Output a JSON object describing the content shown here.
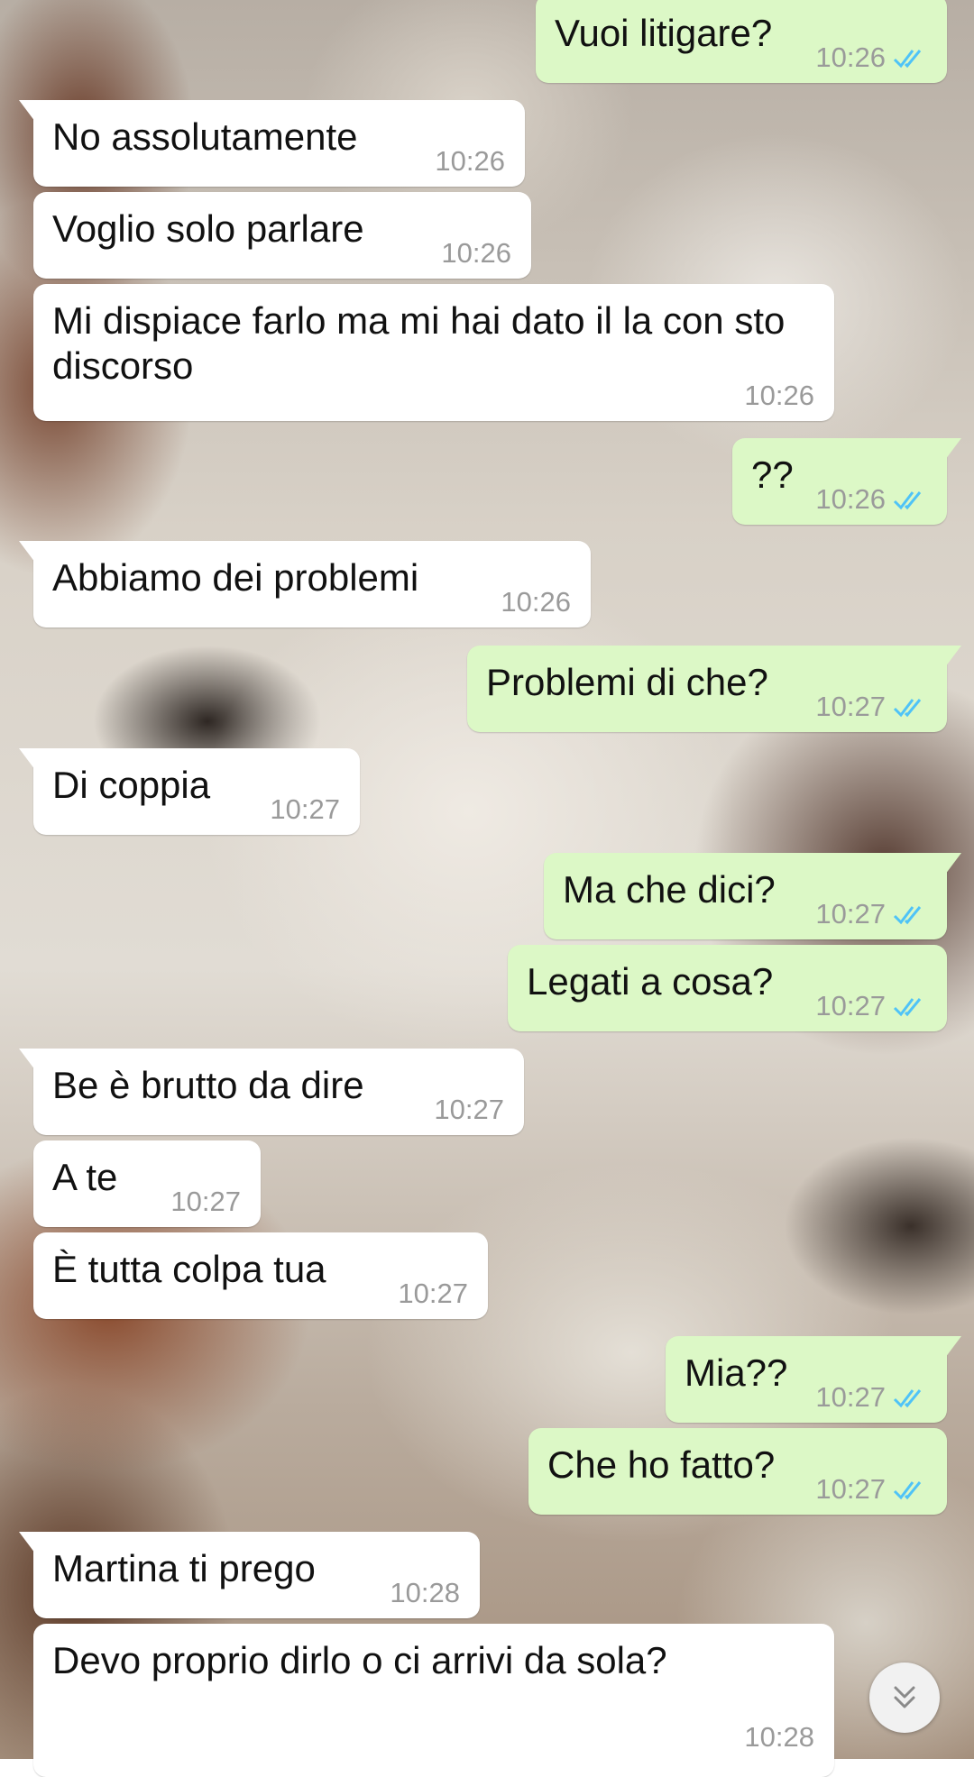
{
  "chat": {
    "messages": [
      {
        "dir": "out",
        "text": "Vuoi litigare?",
        "time": "10:26"
      },
      {
        "dir": "in",
        "text": "No assolutamente",
        "time": "10:26"
      },
      {
        "dir": "in",
        "text": "Voglio solo parlare",
        "time": "10:26"
      },
      {
        "dir": "in",
        "text": "Mi dispiace farlo ma mi hai dato il la con sto discorso",
        "time": "10:26"
      },
      {
        "dir": "out",
        "text": "??",
        "time": "10:26"
      },
      {
        "dir": "in",
        "text": "Abbiamo dei problemi",
        "time": "10:26"
      },
      {
        "dir": "out",
        "text": "Problemi di che?",
        "time": "10:27"
      },
      {
        "dir": "in",
        "text": "Di coppia",
        "time": "10:27"
      },
      {
        "dir": "out",
        "text": "Ma che dici?",
        "time": "10:27"
      },
      {
        "dir": "out",
        "text": "Legati a cosa?",
        "time": "10:27"
      },
      {
        "dir": "in",
        "text": "Be è brutto da dire",
        "time": "10:27"
      },
      {
        "dir": "in",
        "text": "A te",
        "time": "10:27"
      },
      {
        "dir": "in",
        "text": "È tutta colpa tua",
        "time": "10:27"
      },
      {
        "dir": "out",
        "text": "Mia??",
        "time": "10:27"
      },
      {
        "dir": "out",
        "text": "Che ho fatto?",
        "time": "10:27"
      },
      {
        "dir": "in",
        "text": "Martina ti prego",
        "time": "10:28"
      },
      {
        "dir": "in",
        "text": "Devo proprio dirlo o ci arrivi da sola?",
        "time": "10:28"
      }
    ],
    "status_icon": "double-check-read-icon",
    "scroll_button_icon": "chevron-double-down-icon"
  },
  "colors": {
    "incoming_bubble": "#ffffff",
    "outgoing_bubble": "#dcf8c6",
    "timestamp": "#9a9a9a",
    "read_ticks": "#4fc3f7"
  }
}
